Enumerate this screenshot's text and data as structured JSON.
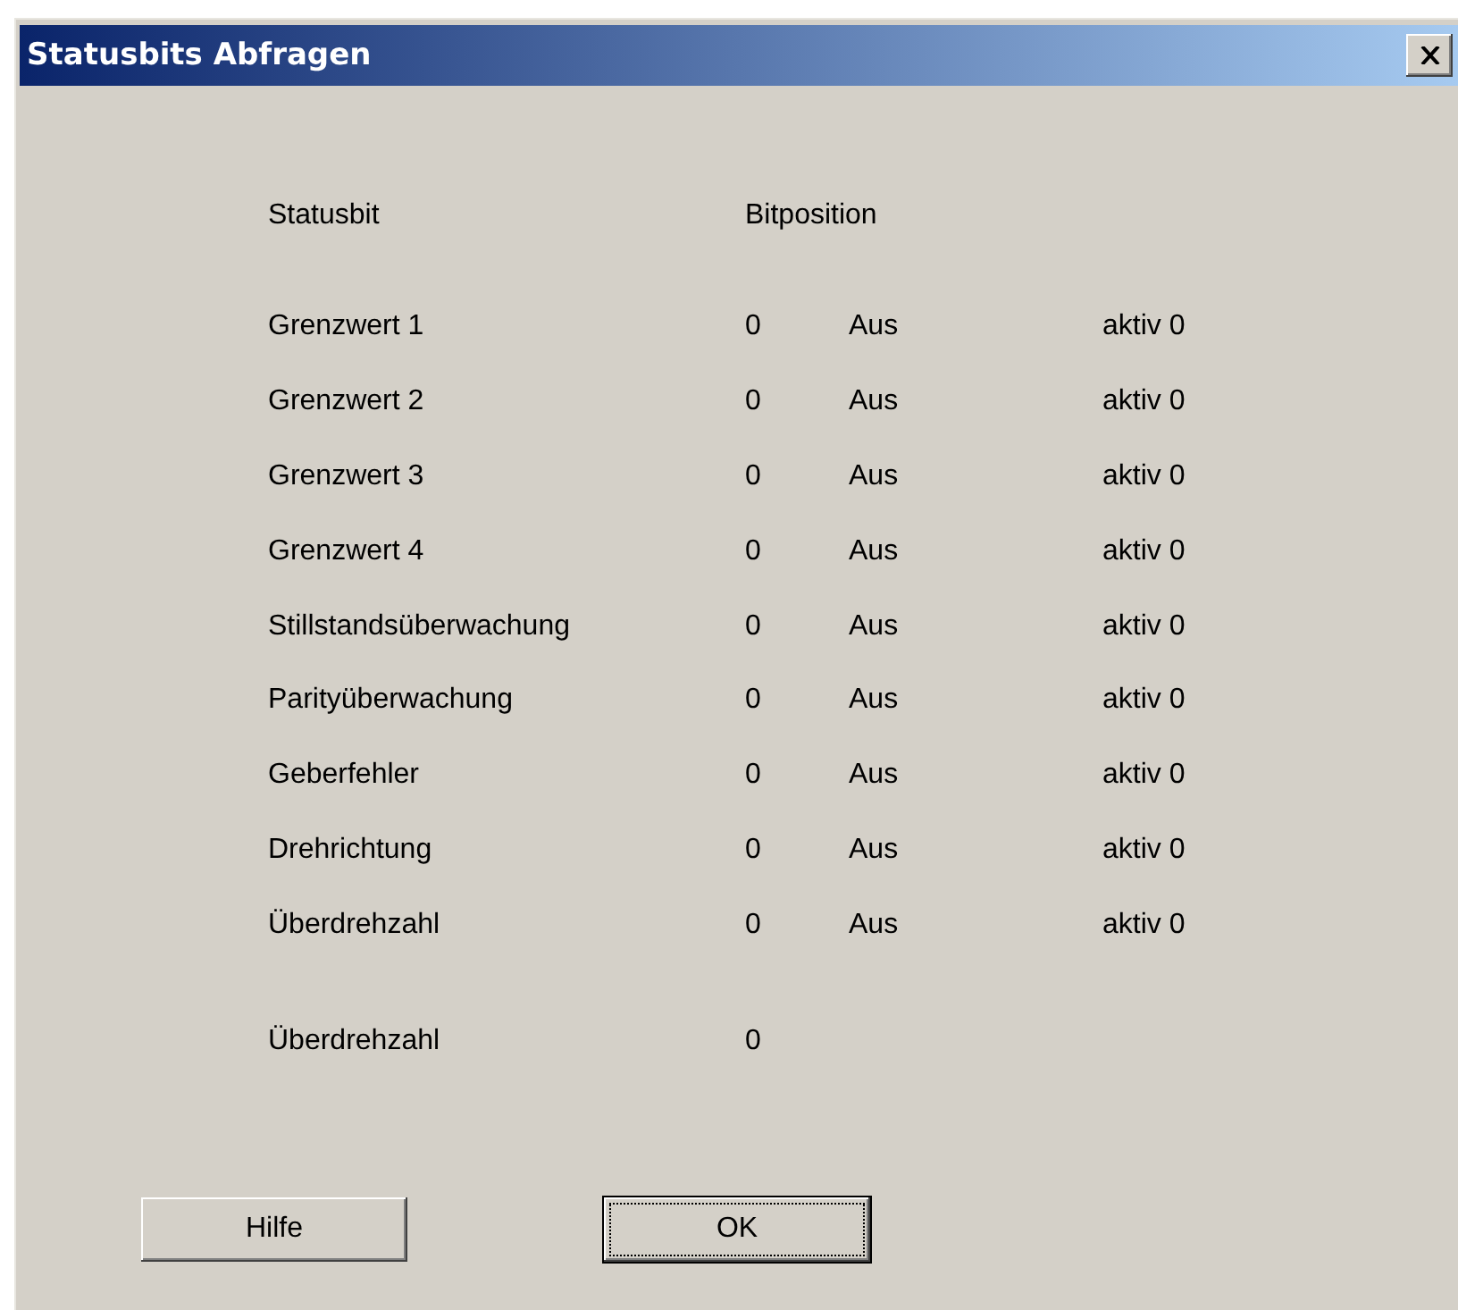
{
  "window": {
    "title": "Statusbits Abfragen"
  },
  "headers": [
    "Statusbit",
    "Bitposition"
  ],
  "rows": [
    {
      "name": "Grenzwert 1",
      "bit": "0",
      "state": "Aus",
      "active": "aktiv 0"
    },
    {
      "name": "Grenzwert 2",
      "bit": "0",
      "state": "Aus",
      "active": "aktiv 0"
    },
    {
      "name": "Grenzwert 3",
      "bit": "0",
      "state": "Aus",
      "active": "aktiv 0"
    },
    {
      "name": "Grenzwert 4",
      "bit": "0",
      "state": "Aus",
      "active": "aktiv 0"
    },
    {
      "name": "Stillstandsüberwachung",
      "bit": "0",
      "state": "Aus",
      "active": "aktiv 0"
    },
    {
      "name": "Parityüberwachung",
      "bit": "0",
      "state": "Aus",
      "active": "aktiv 0"
    },
    {
      "name": "Geberfehler",
      "bit": "0",
      "state": "Aus",
      "active": "aktiv 0"
    },
    {
      "name": "Drehrichtung",
      "bit": "0",
      "state": "Aus",
      "active": "aktiv 0"
    },
    {
      "name": "Überdrehzahl",
      "bit": "0",
      "state": "Aus",
      "active": "aktiv 0"
    }
  ],
  "summary": {
    "label": "Überdrehzahl",
    "value": "0"
  },
  "buttons": [
    {
      "label": "Hilfe",
      "default": false
    },
    {
      "label": "OK",
      "default": true
    }
  ]
}
